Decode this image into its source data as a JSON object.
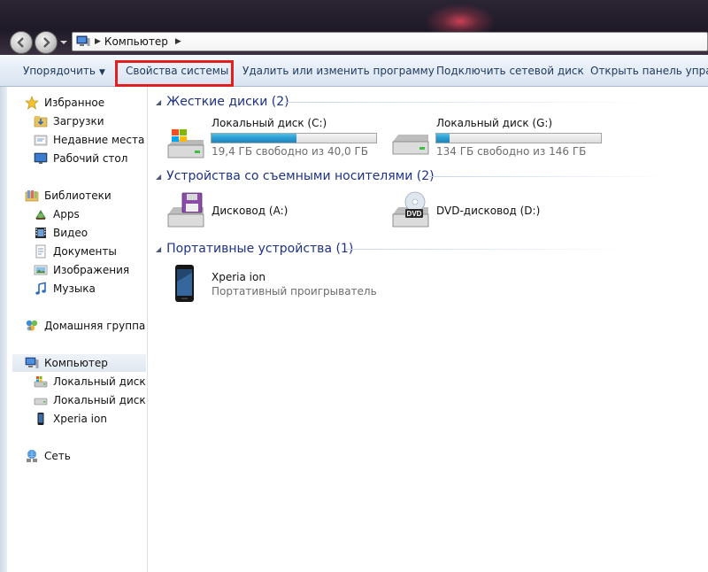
{
  "address": {
    "crumb": "Компьютер"
  },
  "commands": {
    "organize": "Упорядочить",
    "system_properties": "Свойства системы",
    "uninstall": "Удалить или изменить программу",
    "map_drive": "Подключить сетевой диск",
    "control_panel": "Открыть панель управле"
  },
  "sidebar": {
    "favorites": {
      "label": "Избранное",
      "items": [
        "Загрузки",
        "Недавние места",
        "Рабочий стол"
      ]
    },
    "libraries": {
      "label": "Библиотеки",
      "items": [
        "Apps",
        "Видео",
        "Документы",
        "Изображения",
        "Музыка"
      ]
    },
    "homegroup": "Домашняя группа",
    "computer": {
      "label": "Компьютер",
      "items": [
        "Локальный диск (C",
        "Локальный диск (G",
        "Xperia ion"
      ]
    },
    "network": "Сеть"
  },
  "groups": {
    "hard_drives": {
      "title": "Жесткие диски (2)",
      "drives": [
        {
          "name": "Локальный диск (C:)",
          "free": "19,4 ГБ свободно из 40,0 ГБ",
          "used_fraction": 0.515
        },
        {
          "name": "Локальный диск (G:)",
          "free": "134 ГБ свободно из 146 ГБ",
          "used_fraction": 0.08
        }
      ]
    },
    "removable": {
      "title": "Устройства со съемными носителями (2)",
      "items": [
        "Дисковод (A:)",
        "DVD-дисковод (D:)"
      ],
      "dvd_badge": "DVD"
    },
    "portable": {
      "title": "Портативные устройства (1)",
      "device_name": "Xperia ion",
      "device_type": "Портативный проигрыватель"
    }
  },
  "colors": {
    "highlight": "#e02020",
    "group_title": "#1e3287",
    "bar_fill": "#2a9bd1"
  }
}
